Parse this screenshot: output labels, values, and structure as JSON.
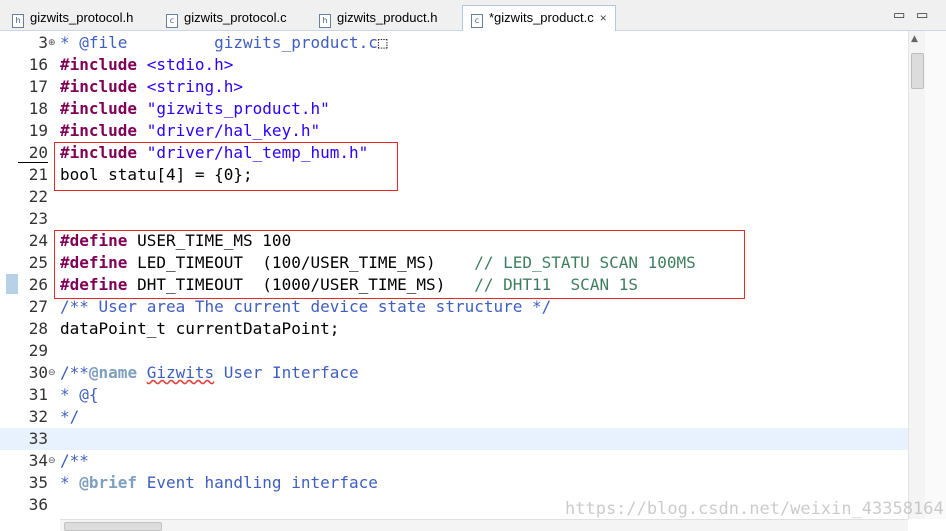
{
  "tabs": [
    {
      "icon": "h",
      "label": "gizwits_protocol.h",
      "active": false
    },
    {
      "icon": "c",
      "label": "gizwits_protocol.c",
      "active": false
    },
    {
      "icon": "h",
      "label": "gizwits_product.h",
      "active": false
    },
    {
      "icon": "c",
      "label": "*gizwits_product.c",
      "active": true,
      "close": "×"
    }
  ],
  "window_controls": {
    "minimize": "▭",
    "maximize": "▭"
  },
  "lines": [
    {
      "num": "3",
      "fold": "⊕",
      "tokens": [
        {
          "t": "dcmt",
          "v": "* @file         gizwits_product.c"
        },
        {
          "t": "plain",
          "v": "⬚"
        }
      ]
    },
    {
      "num": "16",
      "tokens": [
        {
          "t": "kw",
          "v": "#include"
        },
        {
          "t": "plain",
          "v": " "
        },
        {
          "t": "str",
          "v": "<stdio.h>"
        }
      ]
    },
    {
      "num": "17",
      "tokens": [
        {
          "t": "kw",
          "v": "#include"
        },
        {
          "t": "plain",
          "v": " "
        },
        {
          "t": "str",
          "v": "<string.h>"
        }
      ]
    },
    {
      "num": "18",
      "tokens": [
        {
          "t": "kw",
          "v": "#include"
        },
        {
          "t": "plain",
          "v": " "
        },
        {
          "t": "str",
          "v": "\"gizwits_product.h\""
        }
      ]
    },
    {
      "num": "19",
      "tokens": [
        {
          "t": "kw",
          "v": "#include"
        },
        {
          "t": "plain",
          "v": " "
        },
        {
          "t": "str",
          "v": "\"driver/hal_key.h\""
        }
      ]
    },
    {
      "num": "20",
      "tokens": [
        {
          "t": "kw",
          "v": "#include"
        },
        {
          "t": "plain",
          "v": " "
        },
        {
          "t": "str",
          "v": "\"driver/hal_temp_hum.h\""
        }
      ]
    },
    {
      "num": "21",
      "tokens": [
        {
          "t": "plain",
          "v": "bool statu[4] = {0};"
        }
      ]
    },
    {
      "num": "22",
      "tokens": []
    },
    {
      "num": "23",
      "tokens": []
    },
    {
      "num": "24",
      "tokens": [
        {
          "t": "kw",
          "v": "#define"
        },
        {
          "t": "plain",
          "v": " USER_TIME_MS 100"
        }
      ]
    },
    {
      "num": "25",
      "tokens": [
        {
          "t": "kw",
          "v": "#define"
        },
        {
          "t": "plain",
          "v": " LED_TIMEOUT  (100/USER_TIME_MS)    "
        },
        {
          "t": "cmt",
          "v": "// LED_STATU SCAN 100MS"
        }
      ]
    },
    {
      "num": "26",
      "marker": true,
      "tokens": [
        {
          "t": "kw",
          "v": "#define"
        },
        {
          "t": "plain",
          "v": " DHT_TIMEOUT  (1000/USER_TIME_MS)   "
        },
        {
          "t": "cmt",
          "v": "// DHT11  SCAN 1S"
        }
      ]
    },
    {
      "num": "27",
      "tokens": [
        {
          "t": "dcmt",
          "v": "/** User area The current device state structure */"
        }
      ]
    },
    {
      "num": "28",
      "tokens": [
        {
          "t": "plain",
          "v": "dataPoint_t currentDataPoint;"
        }
      ]
    },
    {
      "num": "29",
      "tokens": []
    },
    {
      "num": "30",
      "fold": "⊖",
      "tokens": [
        {
          "t": "dcmt",
          "v": "/**"
        },
        {
          "t": "tag",
          "v": "@name"
        },
        {
          "t": "dcmt",
          "v": " "
        },
        {
          "t": "dcmt squig",
          "v": "Gizwits"
        },
        {
          "t": "dcmt",
          "v": " User Interface"
        }
      ]
    },
    {
      "num": "31",
      "tokens": [
        {
          "t": "dcmt",
          "v": "* @{"
        }
      ]
    },
    {
      "num": "32",
      "tokens": [
        {
          "t": "dcmt",
          "v": "*/"
        }
      ]
    },
    {
      "num": "33",
      "highlight": true,
      "tokens": []
    },
    {
      "num": "34",
      "fold": "⊖",
      "tokens": [
        {
          "t": "dcmt",
          "v": "/**"
        }
      ]
    },
    {
      "num": "35",
      "tokens": [
        {
          "t": "dcmt",
          "v": "* "
        },
        {
          "t": "tag",
          "v": "@brief"
        },
        {
          "t": "dcmt",
          "v": " Event handling interface"
        }
      ]
    },
    {
      "num": "36",
      "tokens": []
    }
  ],
  "watermark": "https://blog.csdn.net/weixin_43358164"
}
